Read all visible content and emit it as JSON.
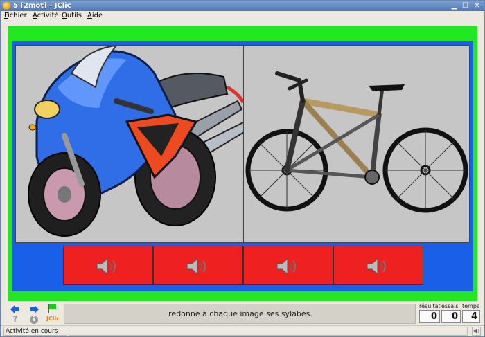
{
  "window": {
    "title": "5 [2mot] - JClic"
  },
  "menu": [
    {
      "label": "Fichier",
      "accel": "F",
      "rest": "ichier"
    },
    {
      "label": "Activité",
      "accel": "A",
      "rest": "ctivité"
    },
    {
      "label": "Outils",
      "accel": "O",
      "rest": "utils"
    },
    {
      "label": "Aide",
      "accel": "A",
      "rest": "ide"
    }
  ],
  "activity": {
    "images": [
      {
        "name": "motorcycle"
      },
      {
        "name": "bicycle"
      }
    ],
    "sound_cells": 4,
    "colors": {
      "frame": "#22e822",
      "inner": "#1a5fe8",
      "cell": "#ee2020",
      "panel": "#c6c6c6"
    }
  },
  "controls": {
    "message": "redonne à chaque image ses sylabes.",
    "logo": "JClic",
    "counters": {
      "result_label": "résultat",
      "result": "0",
      "tries_label": "essais",
      "tries": "0",
      "time_label": "temps",
      "time": "4"
    }
  },
  "status": {
    "text": "Activité en cours"
  }
}
